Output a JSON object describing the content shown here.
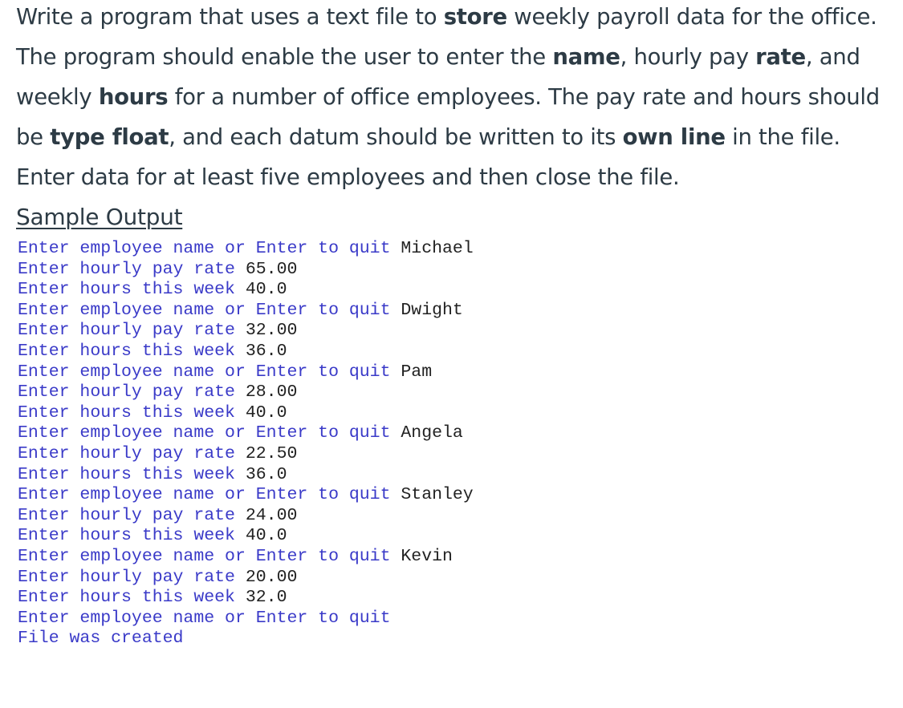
{
  "problem": {
    "segments": [
      {
        "text": "Write a program that uses a text file to ",
        "bold": false
      },
      {
        "text": "store",
        "bold": true
      },
      {
        "text": " weekly payroll data for the office. The program should enable the user to enter the ",
        "bold": false
      },
      {
        "text": "name",
        "bold": true
      },
      {
        "text": ", hourly pay ",
        "bold": false
      },
      {
        "text": "rate",
        "bold": true
      },
      {
        "text": ", and weekly ",
        "bold": false
      },
      {
        "text": "hours",
        "bold": true
      },
      {
        "text": " for a number of office employees. The pay rate and hours should be ",
        "bold": false
      },
      {
        "text": "type float",
        "bold": true
      },
      {
        "text": ", and each datum should be written to its ",
        "bold": false
      },
      {
        "text": "own line",
        "bold": true
      },
      {
        "text": " in the file. Enter data for at least five employees and then close the file.",
        "bold": false
      }
    ]
  },
  "sample_output": {
    "heading": "Sample Output",
    "colors": {
      "prompt": "#3a3ac8",
      "input": "#222222"
    },
    "lines": [
      {
        "prompt": "Enter employee name or Enter to quit ",
        "input": "Michael"
      },
      {
        "prompt": "Enter hourly pay rate ",
        "input": "65.00"
      },
      {
        "prompt": "Enter hours this week ",
        "input": "40.0"
      },
      {
        "prompt": "Enter employee name or Enter to quit ",
        "input": "Dwight"
      },
      {
        "prompt": "Enter hourly pay rate ",
        "input": "32.00"
      },
      {
        "prompt": "Enter hours this week ",
        "input": "36.0"
      },
      {
        "prompt": "Enter employee name or Enter to quit ",
        "input": "Pam"
      },
      {
        "prompt": "Enter hourly pay rate ",
        "input": "28.00"
      },
      {
        "prompt": "Enter hours this week ",
        "input": "40.0"
      },
      {
        "prompt": "Enter employee name or Enter to quit ",
        "input": "Angela"
      },
      {
        "prompt": "Enter hourly pay rate ",
        "input": "22.50"
      },
      {
        "prompt": "Enter hours this week ",
        "input": "36.0"
      },
      {
        "prompt": "Enter employee name or Enter to quit ",
        "input": "Stanley"
      },
      {
        "prompt": "Enter hourly pay rate ",
        "input": "24.00"
      },
      {
        "prompt": "Enter hours this week ",
        "input": "40.0"
      },
      {
        "prompt": "Enter employee name or Enter to quit ",
        "input": "Kevin"
      },
      {
        "prompt": "Enter hourly pay rate ",
        "input": "20.00"
      },
      {
        "prompt": "Enter hours this week ",
        "input": "32.0"
      },
      {
        "prompt": "Enter employee name or Enter to quit",
        "input": ""
      },
      {
        "prompt": "File was created",
        "input": ""
      }
    ]
  }
}
